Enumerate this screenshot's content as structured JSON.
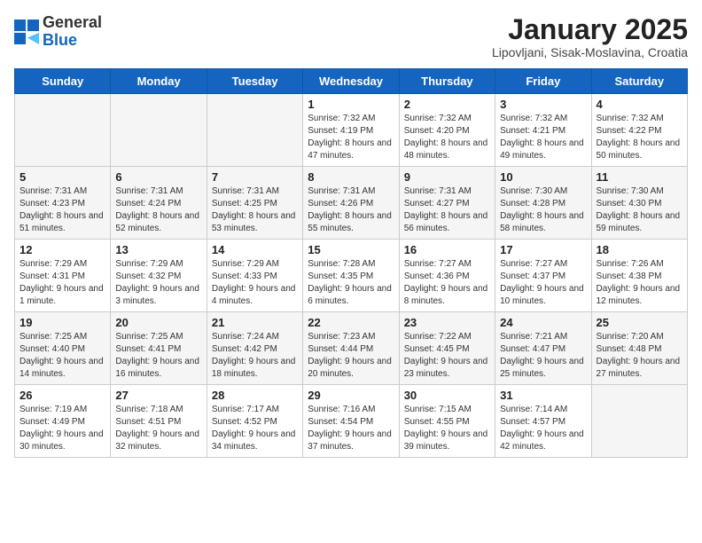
{
  "header": {
    "logo_general": "General",
    "logo_blue": "Blue",
    "month_title": "January 2025",
    "subtitle": "Lipovljani, Sisak-Moslavina, Croatia"
  },
  "days_of_week": [
    "Sunday",
    "Monday",
    "Tuesday",
    "Wednesday",
    "Thursday",
    "Friday",
    "Saturday"
  ],
  "weeks": [
    {
      "days": [
        {
          "number": "",
          "info": ""
        },
        {
          "number": "",
          "info": ""
        },
        {
          "number": "",
          "info": ""
        },
        {
          "number": "1",
          "info": "Sunrise: 7:32 AM\nSunset: 4:19 PM\nDaylight: 8 hours and 47 minutes."
        },
        {
          "number": "2",
          "info": "Sunrise: 7:32 AM\nSunset: 4:20 PM\nDaylight: 8 hours and 48 minutes."
        },
        {
          "number": "3",
          "info": "Sunrise: 7:32 AM\nSunset: 4:21 PM\nDaylight: 8 hours and 49 minutes."
        },
        {
          "number": "4",
          "info": "Sunrise: 7:32 AM\nSunset: 4:22 PM\nDaylight: 8 hours and 50 minutes."
        }
      ]
    },
    {
      "days": [
        {
          "number": "5",
          "info": "Sunrise: 7:31 AM\nSunset: 4:23 PM\nDaylight: 8 hours and 51 minutes."
        },
        {
          "number": "6",
          "info": "Sunrise: 7:31 AM\nSunset: 4:24 PM\nDaylight: 8 hours and 52 minutes."
        },
        {
          "number": "7",
          "info": "Sunrise: 7:31 AM\nSunset: 4:25 PM\nDaylight: 8 hours and 53 minutes."
        },
        {
          "number": "8",
          "info": "Sunrise: 7:31 AM\nSunset: 4:26 PM\nDaylight: 8 hours and 55 minutes."
        },
        {
          "number": "9",
          "info": "Sunrise: 7:31 AM\nSunset: 4:27 PM\nDaylight: 8 hours and 56 minutes."
        },
        {
          "number": "10",
          "info": "Sunrise: 7:30 AM\nSunset: 4:28 PM\nDaylight: 8 hours and 58 minutes."
        },
        {
          "number": "11",
          "info": "Sunrise: 7:30 AM\nSunset: 4:30 PM\nDaylight: 8 hours and 59 minutes."
        }
      ]
    },
    {
      "days": [
        {
          "number": "12",
          "info": "Sunrise: 7:29 AM\nSunset: 4:31 PM\nDaylight: 9 hours and 1 minute."
        },
        {
          "number": "13",
          "info": "Sunrise: 7:29 AM\nSunset: 4:32 PM\nDaylight: 9 hours and 3 minutes."
        },
        {
          "number": "14",
          "info": "Sunrise: 7:29 AM\nSunset: 4:33 PM\nDaylight: 9 hours and 4 minutes."
        },
        {
          "number": "15",
          "info": "Sunrise: 7:28 AM\nSunset: 4:35 PM\nDaylight: 9 hours and 6 minutes."
        },
        {
          "number": "16",
          "info": "Sunrise: 7:27 AM\nSunset: 4:36 PM\nDaylight: 9 hours and 8 minutes."
        },
        {
          "number": "17",
          "info": "Sunrise: 7:27 AM\nSunset: 4:37 PM\nDaylight: 9 hours and 10 minutes."
        },
        {
          "number": "18",
          "info": "Sunrise: 7:26 AM\nSunset: 4:38 PM\nDaylight: 9 hours and 12 minutes."
        }
      ]
    },
    {
      "days": [
        {
          "number": "19",
          "info": "Sunrise: 7:25 AM\nSunset: 4:40 PM\nDaylight: 9 hours and 14 minutes."
        },
        {
          "number": "20",
          "info": "Sunrise: 7:25 AM\nSunset: 4:41 PM\nDaylight: 9 hours and 16 minutes."
        },
        {
          "number": "21",
          "info": "Sunrise: 7:24 AM\nSunset: 4:42 PM\nDaylight: 9 hours and 18 minutes."
        },
        {
          "number": "22",
          "info": "Sunrise: 7:23 AM\nSunset: 4:44 PM\nDaylight: 9 hours and 20 minutes."
        },
        {
          "number": "23",
          "info": "Sunrise: 7:22 AM\nSunset: 4:45 PM\nDaylight: 9 hours and 23 minutes."
        },
        {
          "number": "24",
          "info": "Sunrise: 7:21 AM\nSunset: 4:47 PM\nDaylight: 9 hours and 25 minutes."
        },
        {
          "number": "25",
          "info": "Sunrise: 7:20 AM\nSunset: 4:48 PM\nDaylight: 9 hours and 27 minutes."
        }
      ]
    },
    {
      "days": [
        {
          "number": "26",
          "info": "Sunrise: 7:19 AM\nSunset: 4:49 PM\nDaylight: 9 hours and 30 minutes."
        },
        {
          "number": "27",
          "info": "Sunrise: 7:18 AM\nSunset: 4:51 PM\nDaylight: 9 hours and 32 minutes."
        },
        {
          "number": "28",
          "info": "Sunrise: 7:17 AM\nSunset: 4:52 PM\nDaylight: 9 hours and 34 minutes."
        },
        {
          "number": "29",
          "info": "Sunrise: 7:16 AM\nSunset: 4:54 PM\nDaylight: 9 hours and 37 minutes."
        },
        {
          "number": "30",
          "info": "Sunrise: 7:15 AM\nSunset: 4:55 PM\nDaylight: 9 hours and 39 minutes."
        },
        {
          "number": "31",
          "info": "Sunrise: 7:14 AM\nSunset: 4:57 PM\nDaylight: 9 hours and 42 minutes."
        },
        {
          "number": "",
          "info": ""
        }
      ]
    }
  ]
}
